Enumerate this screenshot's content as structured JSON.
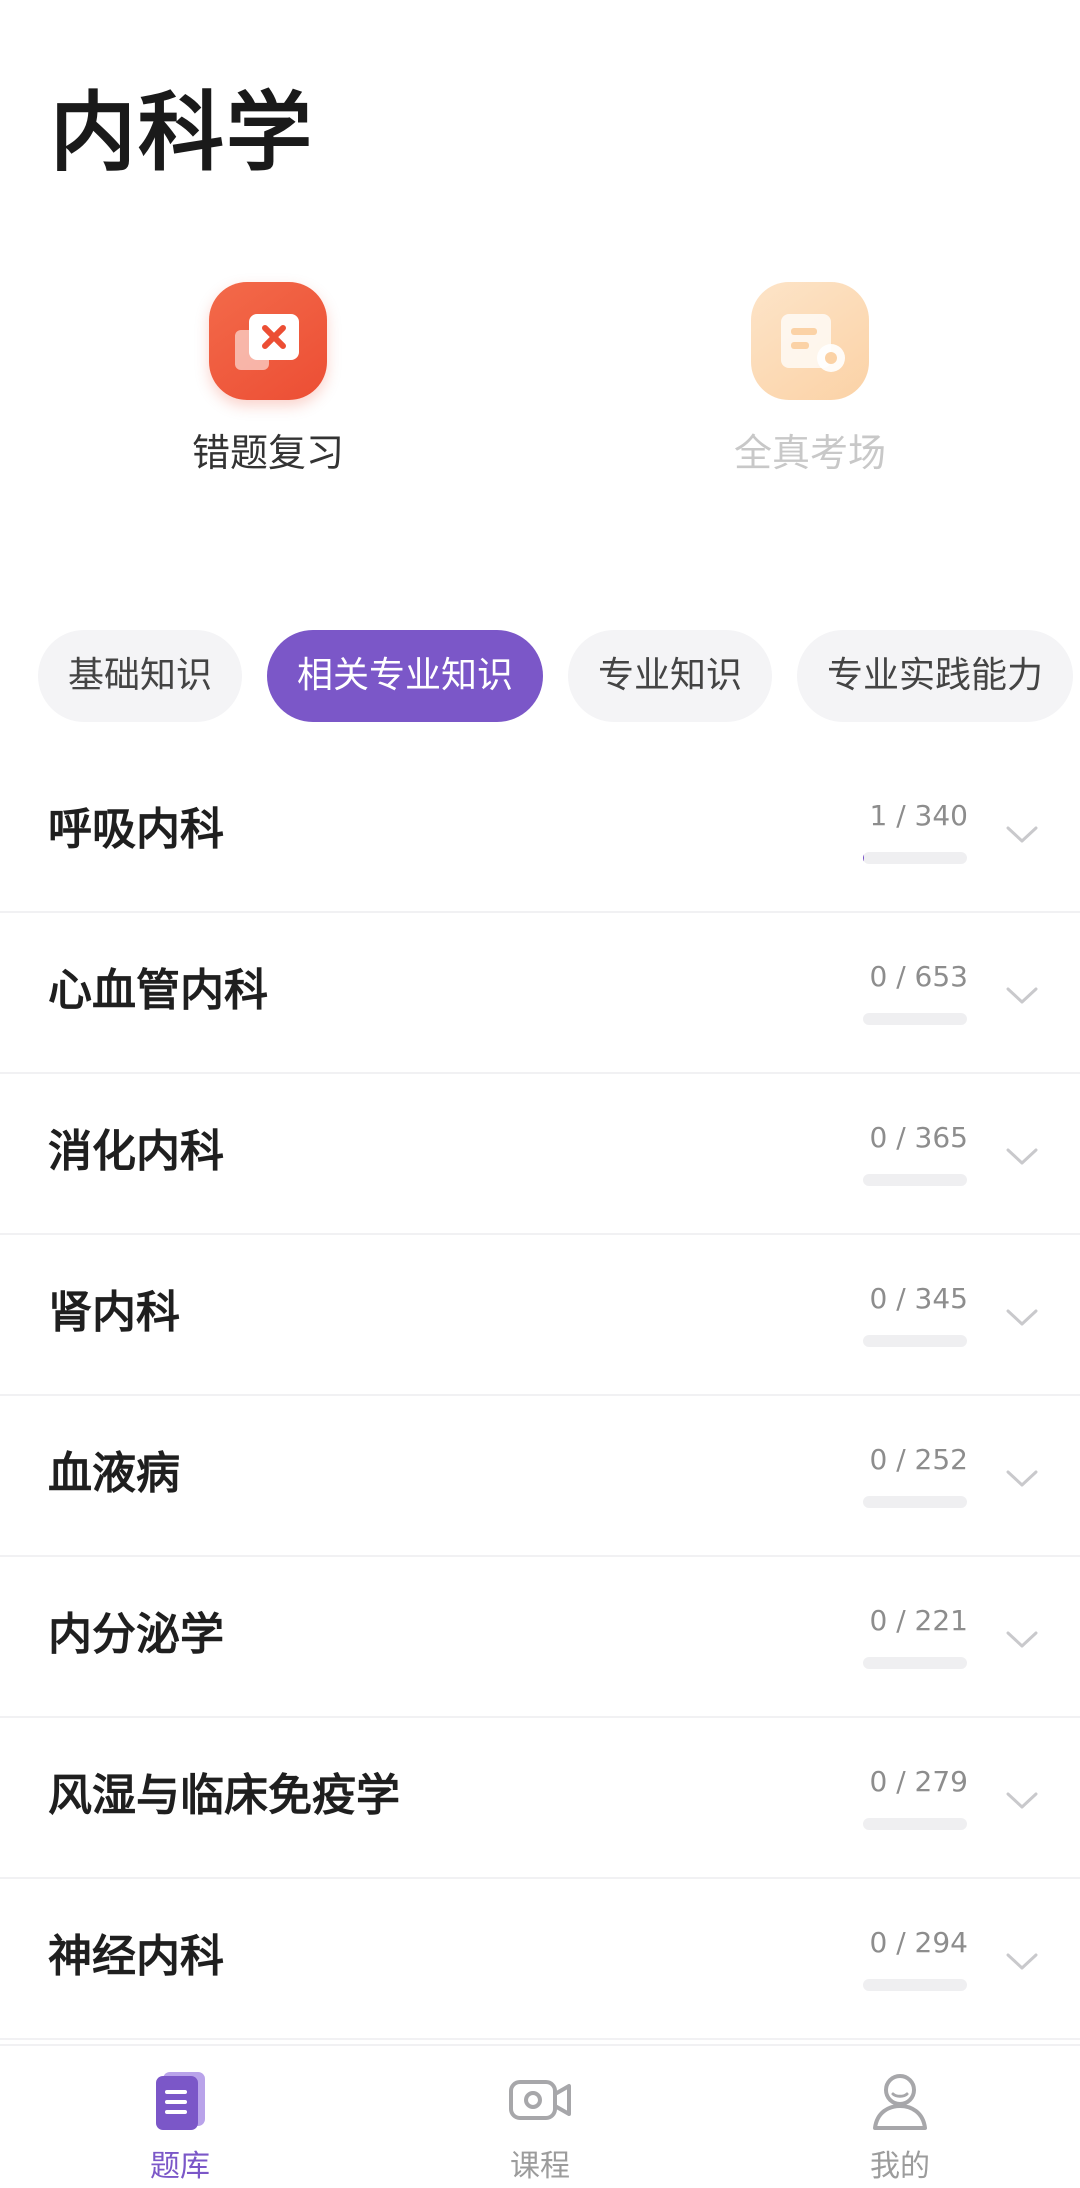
{
  "header": {
    "title": "内科学"
  },
  "quick_actions": [
    {
      "label": "错题复习",
      "icon": "wrong-questions-icon",
      "color": "#f05a3c",
      "enabled": true
    },
    {
      "label": "全真考场",
      "icon": "mock-exam-icon",
      "color": "#fbd7b0",
      "enabled": false
    }
  ],
  "tabs": [
    {
      "label": "基础知识",
      "active": false
    },
    {
      "label": "相关专业知识",
      "active": true
    },
    {
      "label": "专业知识",
      "active": false
    },
    {
      "label": "专业实践能力",
      "active": false
    }
  ],
  "chapters": [
    {
      "name": "呼吸内科",
      "progress_text": "1 / 340",
      "done": 1,
      "total": 340
    },
    {
      "name": "心血管内科",
      "progress_text": "0 / 653",
      "done": 0,
      "total": 653
    },
    {
      "name": "消化内科",
      "progress_text": "0 / 365",
      "done": 0,
      "total": 365
    },
    {
      "name": "肾内科",
      "progress_text": "0 / 345",
      "done": 0,
      "total": 345
    },
    {
      "name": "血液病",
      "progress_text": "0 / 252",
      "done": 0,
      "total": 252
    },
    {
      "name": "内分泌学",
      "progress_text": "0 / 221",
      "done": 0,
      "total": 221
    },
    {
      "name": "风湿与临床免疫学",
      "progress_text": "0 / 279",
      "done": 0,
      "total": 279
    },
    {
      "name": "神经内科",
      "progress_text": "0 / 294",
      "done": 0,
      "total": 294
    }
  ],
  "bottom_nav": [
    {
      "label": "题库",
      "icon": "question-bank-icon",
      "active": true
    },
    {
      "label": "课程",
      "icon": "course-video-icon",
      "active": false
    },
    {
      "label": "我的",
      "icon": "profile-icon",
      "active": false
    }
  ],
  "colors": {
    "accent": "#7b57c8",
    "tab_inactive_bg": "#f4f4f6",
    "progress_track": "#efeff1"
  }
}
